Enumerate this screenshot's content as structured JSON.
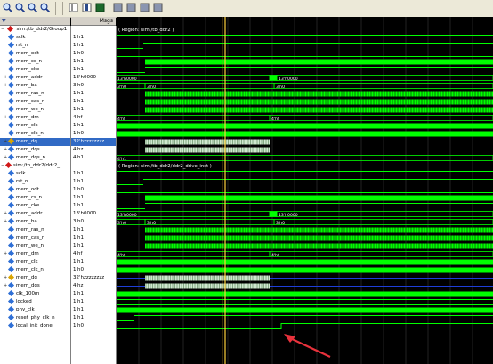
{
  "header": {
    "msgs_label": "Msgs"
  },
  "group1": {
    "title": "sim:/tb_ddr2/Group1",
    "region": "( Region: sim:/tb_ddr2 )",
    "signals": [
      {
        "name": "sclk",
        "value": "1'h1",
        "color": "#2e6fd6"
      },
      {
        "name": "rst_n",
        "value": "1'h1",
        "color": "#2e6fd6"
      },
      {
        "name": "mem_odt",
        "value": "1'h0",
        "color": "#2e6fd6"
      },
      {
        "name": "mem_cs_n",
        "value": "1'h1",
        "color": "#2e6fd6"
      },
      {
        "name": "mem_cke",
        "value": "1'h1",
        "color": "#2e6fd6"
      },
      {
        "name": "mem_addr",
        "value": "13'h0000",
        "color": "#2e6fd6"
      },
      {
        "name": "mem_ba",
        "value": "3'h0",
        "color": "#2e6fd6"
      },
      {
        "name": "mem_ras_n",
        "value": "1'h1",
        "color": "#2e6fd6"
      },
      {
        "name": "mem_cas_n",
        "value": "1'h1",
        "color": "#2e6fd6"
      },
      {
        "name": "mem_we_n",
        "value": "1'h1",
        "color": "#2e6fd6"
      },
      {
        "name": "mem_dm",
        "value": "4'hf",
        "color": "#2e6fd6"
      },
      {
        "name": "mem_clk",
        "value": "1'h1",
        "color": "#2e6fd6"
      },
      {
        "name": "mem_clk_n",
        "value": "1'h0",
        "color": "#2e6fd6"
      },
      {
        "name": "mem_dq",
        "value": "32'hzzzzzzzz",
        "color": "#d9a400",
        "selected": true
      },
      {
        "name": "mem_dqs",
        "value": "4'hz",
        "color": "#2e6fd6"
      },
      {
        "name": "mem_dqs_n",
        "value": "4'h1",
        "color": "#2e6fd6"
      }
    ]
  },
  "group2": {
    "title": "sim:/tb_ddr2/ddr2_...",
    "region": "( Region: sim:/tb_ddr2/ddr2_drive_inst )",
    "signals": [
      {
        "name": "sclk",
        "value": "1'h1",
        "color": "#2e6fd6"
      },
      {
        "name": "rst_n",
        "value": "1'h1",
        "color": "#2e6fd6"
      },
      {
        "name": "mem_odt",
        "value": "1'h0",
        "color": "#2e6fd6"
      },
      {
        "name": "mem_cs_n",
        "value": "1'h1",
        "color": "#2e6fd6"
      },
      {
        "name": "mem_cke",
        "value": "1'h1",
        "color": "#2e6fd6"
      },
      {
        "name": "mem_addr",
        "value": "13'h0000",
        "color": "#2e6fd6"
      },
      {
        "name": "mem_ba",
        "value": "3'h0",
        "color": "#2e6fd6"
      },
      {
        "name": "mem_ras_n",
        "value": "1'h1",
        "color": "#2e6fd6"
      },
      {
        "name": "mem_cas_n",
        "value": "1'h1",
        "color": "#2e6fd6"
      },
      {
        "name": "mem_we_n",
        "value": "1'h1",
        "color": "#2e6fd6"
      },
      {
        "name": "mem_dm",
        "value": "4'hf",
        "color": "#2e6fd6"
      },
      {
        "name": "mem_clk",
        "value": "1'h1",
        "color": "#2e6fd6"
      },
      {
        "name": "mem_clk_n",
        "value": "1'h0",
        "color": "#2e6fd6"
      },
      {
        "name": "mem_dq",
        "value": "32'hzzzzzzzz",
        "color": "#d9a400"
      },
      {
        "name": "mem_dqs",
        "value": "4'hz",
        "color": "#2e6fd6"
      },
      {
        "name": "clk_100m",
        "value": "1'h1",
        "color": "#2e6fd6"
      },
      {
        "name": "locked",
        "value": "1'h1",
        "color": "#2e6fd6"
      },
      {
        "name": "phy_clk",
        "value": "1'h1",
        "color": "#2e6fd6"
      },
      {
        "name": "reset_phy_clk_n",
        "value": "1'h1",
        "color": "#2e6fd6"
      },
      {
        "name": "local_init_done",
        "value": "1'h0",
        "color": "#2e6fd6"
      }
    ]
  },
  "bus_labels": {
    "addr_a": "13'h0000",
    "addr_b": "13'h0000",
    "ba_a": "3'h0",
    "ba_b": "3'h0",
    "ba_c": "3'h0",
    "dm_a": "4'hf",
    "dm_b": "4'hf",
    "dqs_n_a": "4'h1"
  },
  "colors": {
    "wave": "#00ff00",
    "cursor": "#ffd23c",
    "grid": "#3a3a3a",
    "annotation": "#e8323c"
  }
}
